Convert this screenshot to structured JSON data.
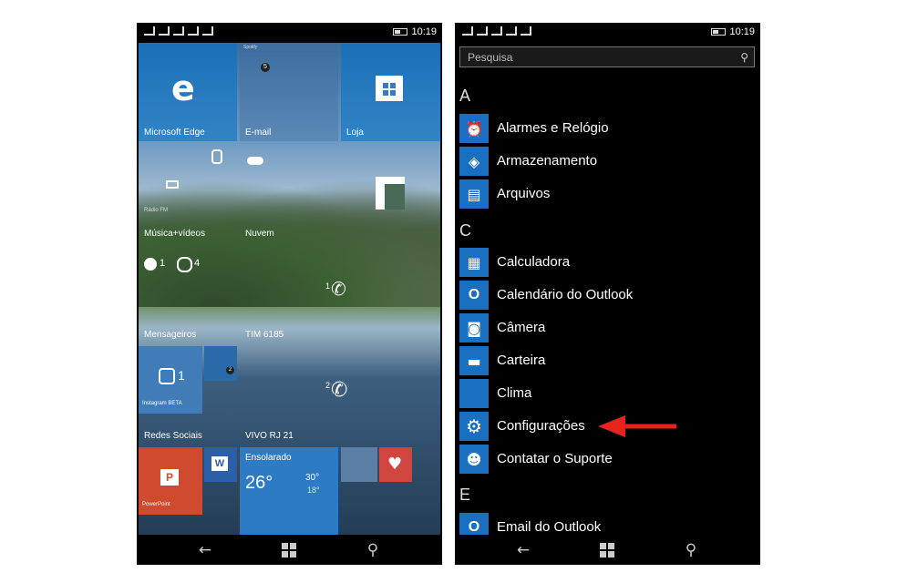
{
  "left_phone": {
    "time": "10:19",
    "tiles": {
      "edge": {
        "label": "Microsoft Edge"
      },
      "email": {
        "label": "E-mail",
        "badge": "5",
        "header": "Spotify"
      },
      "store": {
        "label": "Loja"
      },
      "music": {
        "label": "Música+vídeos",
        "sub": "Rádio FM"
      },
      "cloud": {
        "label": "Nuvem"
      },
      "messengers": {
        "label": "Mensageiros",
        "count_messenger": "1",
        "count_whatsapp": "4"
      },
      "tim": {
        "label": "TIM 6185",
        "count": "1"
      },
      "social": {
        "label": "Redes Sociais",
        "instagram_count": "1",
        "instagram_label": "Instagram BETA",
        "twitter_badge": "2"
      },
      "vivo": {
        "label": "VIVO RJ 21",
        "count": "2"
      },
      "powerpoint": {
        "label": "PowerPoint"
      },
      "weather": {
        "title": "Ensolarado",
        "temp": "26°",
        "high": "30°",
        "low": "18°"
      }
    }
  },
  "right_phone": {
    "time": "10:19",
    "search_placeholder": "Pesquisa",
    "sections": [
      {
        "letter": "A",
        "apps": [
          "Alarmes e Relógio",
          "Armazenamento",
          "Arquivos"
        ]
      },
      {
        "letter": "C",
        "apps": [
          "Calculadora",
          "Calendário do Outlook",
          "Câmera",
          "Carteira",
          "Clima",
          "Configurações",
          "Contatar o Suporte"
        ]
      },
      {
        "letter": "E",
        "apps": [
          "Email do Outlook"
        ]
      }
    ]
  },
  "colors": {
    "accent": "#1a6fc1",
    "arrow": "#e8231b"
  }
}
